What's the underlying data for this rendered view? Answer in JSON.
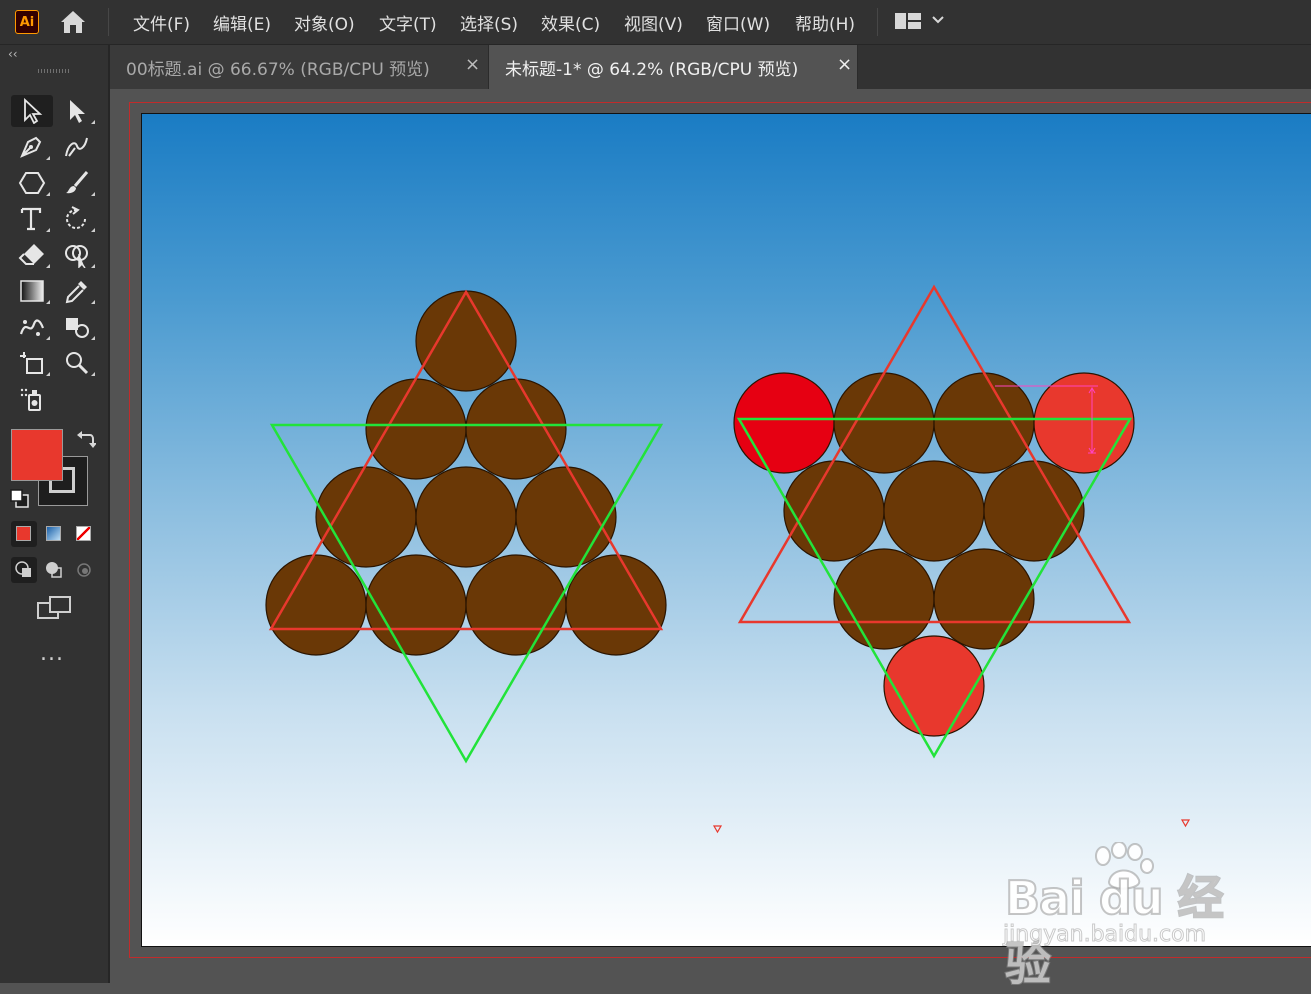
{
  "app": {
    "logo": "Ai"
  },
  "menu": [
    "文件(F)",
    "编辑(E)",
    "对象(O)",
    "文字(T)",
    "选择(S)",
    "效果(C)",
    "视图(V)",
    "窗口(W)",
    "帮助(H)"
  ],
  "icons": {
    "home": "home-icon",
    "workspace": "workspace-layout-icon",
    "chevron": "chevron-down-icon",
    "collapse": "collapse-panel-icon"
  },
  "tabs": [
    {
      "label": "00标题.ai @ 66.67% (RGB/CPU 预览)",
      "close": "×",
      "active": false
    },
    {
      "label": "未标题-1* @ 64.2% (RGB/CPU 预览)",
      "close": "×",
      "active": true
    }
  ],
  "toolbar": {
    "tools": [
      "selection-tool",
      "direct-selection-tool",
      "pen-tool",
      "curvature-tool",
      "polygon-tool",
      "paintbrush-tool",
      "type-tool",
      "rotate-tool",
      "eraser-tool",
      "shape-builder-tool",
      "gradient-tool",
      "eyedropper-tool",
      "puppet-warp-tool",
      "blend-tool",
      "artboard-tool",
      "zoom-tool",
      "symbol-sprayer-tool"
    ],
    "active_tool": "selection-tool",
    "fill_color": "#e8382d",
    "stroke_color": "#1e1e1e",
    "more": "..."
  },
  "artwork": {
    "colors": {
      "brown": "#6a3806",
      "red_dark": "#e60012",
      "red": "#e8382d",
      "triangle_red": "#e8382d",
      "triangle_green": "#22e33a"
    }
  },
  "watermark": {
    "brand": "Bai du 经验",
    "url": "jingyan.baidu.com"
  }
}
